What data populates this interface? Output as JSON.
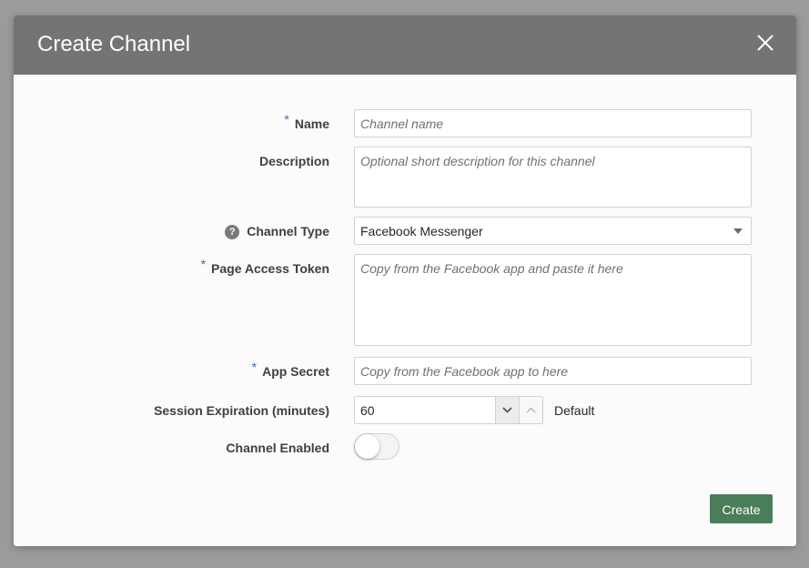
{
  "dialog": {
    "title": "Create Channel",
    "close_icon": "close-icon",
    "create_label": "Create",
    "accent_color": "#4a7d5a",
    "header_color": "#747474"
  },
  "form": {
    "required_marker": "*",
    "name": {
      "label": "Name",
      "placeholder": "Channel name",
      "value": ""
    },
    "description": {
      "label": "Description",
      "placeholder": "Optional short description for this channel",
      "value": ""
    },
    "channel_type": {
      "label": "Channel Type",
      "help_icon": "?",
      "selected": "Facebook Messenger"
    },
    "page_access_token": {
      "label": "Page Access Token",
      "placeholder": "Copy from the Facebook app and paste it here",
      "value": ""
    },
    "app_secret": {
      "label": "App Secret",
      "placeholder": "Copy from the Facebook app to here",
      "value": ""
    },
    "session_expiration": {
      "label": "Session Expiration (minutes)",
      "value": "60",
      "suffix": "Default"
    },
    "channel_enabled": {
      "label": "Channel Enabled",
      "enabled": false
    }
  }
}
